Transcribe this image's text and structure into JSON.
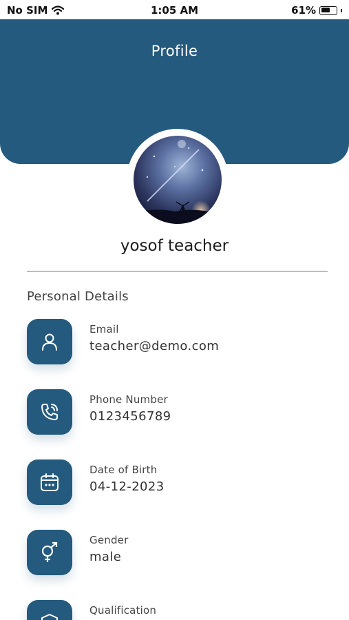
{
  "status": {
    "carrier": "No SIM",
    "time": "1:05 AM",
    "battery": "61%",
    "battery_level": 0.61
  },
  "header": {
    "title": "Profile"
  },
  "profile": {
    "name": "yosof teacher"
  },
  "section": {
    "title": "Personal Details"
  },
  "details": [
    {
      "label": "Email",
      "value": "teacher@demo.com",
      "icon": "person-icon"
    },
    {
      "label": "Phone Number",
      "value": "0123456789",
      "icon": "phone-icon"
    },
    {
      "label": "Date of Birth",
      "value": "04-12-2023",
      "icon": "calendar-icon"
    },
    {
      "label": "Gender",
      "value": "male",
      "icon": "gender-icon"
    },
    {
      "label": "Qualification",
      "value": "",
      "icon": "shield-icon"
    }
  ],
  "colors": {
    "primary": "#245a7d",
    "background": "#ffffff"
  }
}
